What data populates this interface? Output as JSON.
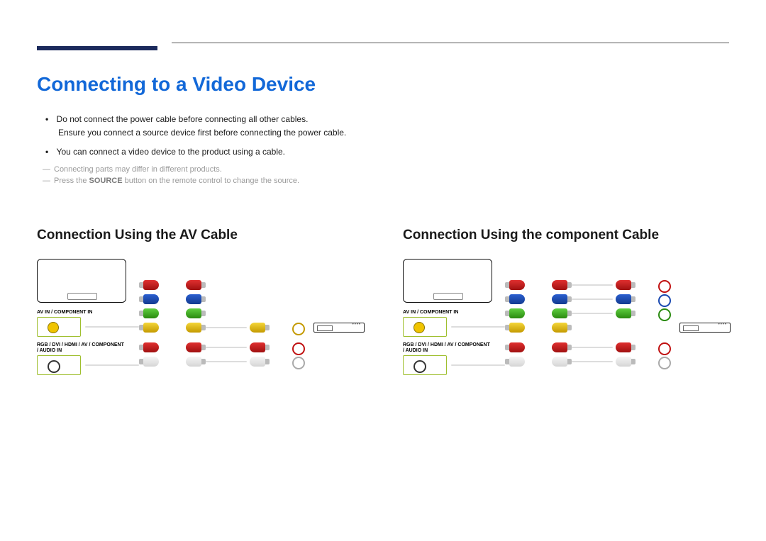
{
  "page_title": "Connecting to a Video Device",
  "bullets": [
    {
      "text": "Do not connect the power cable before connecting all other cables.",
      "sub": "Ensure you connect a source device first before connecting the power cable."
    },
    {
      "text": "You can connect a video device to the product using a cable."
    }
  ],
  "notes": {
    "n1": "Connecting parts may differ in different products.",
    "n2_pre": "Press the ",
    "n2_strong": "SOURCE",
    "n2_post": " button on the remote control to change the source."
  },
  "left": {
    "heading": "Connection Using the AV Cable",
    "label_top": "AV IN / COMPONENT IN",
    "label_mid1": "RGB / DVI / HDMI / AV / COMPONENT",
    "label_mid2": "/ AUDIO IN"
  },
  "right": {
    "heading": "Connection Using the component Cable",
    "label_top": "AV IN / COMPONENT IN",
    "label_mid1": "RGB / DVI / HDMI / AV / COMPONENT",
    "label_mid2": "/ AUDIO IN"
  },
  "colors": {
    "heading_blue": "#1268d8",
    "tab_navy": "#1b2a5c"
  }
}
